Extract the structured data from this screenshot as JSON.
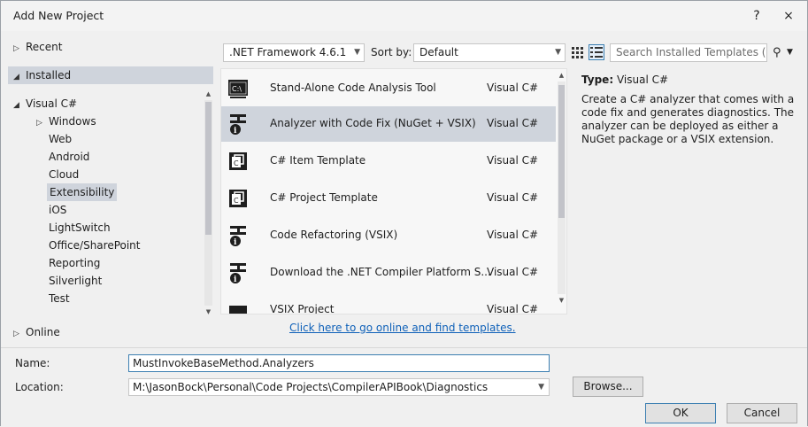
{
  "window": {
    "title": "Add New Project",
    "help": "?",
    "close": "×"
  },
  "tree": {
    "recent": "Recent",
    "installed": "Installed",
    "visual_csharp": "Visual C#",
    "children": [
      "Windows",
      "Web",
      "Android",
      "Cloud",
      "Extensibility",
      "iOS",
      "LightSwitch",
      "Office/SharePoint",
      "Reporting",
      "Silverlight",
      "Test"
    ],
    "online": "Online"
  },
  "toolbar": {
    "framework": ".NET Framework 4.6.1",
    "sort_label": "Sort by:",
    "sort_value": "Default",
    "search_placeholder": "Search Installed Templates (Ct"
  },
  "templates": [
    {
      "name": "Stand-Alone Code Analysis Tool",
      "lang": "Visual C#",
      "icon": "console-cs-icon"
    },
    {
      "name": "Analyzer with Code Fix (NuGet + VSIX)",
      "lang": "Visual C#",
      "icon": "analyzer-icon"
    },
    {
      "name": "C# Item Template",
      "lang": "Visual C#",
      "icon": "item-template-icon"
    },
    {
      "name": "C# Project Template",
      "lang": "Visual C#",
      "icon": "project-template-icon"
    },
    {
      "name": "Code Refactoring (VSIX)",
      "lang": "Visual C#",
      "icon": "refactoring-icon"
    },
    {
      "name": "Download the .NET Compiler Platform S...",
      "lang": "Visual C#",
      "icon": "download-icon"
    },
    {
      "name": "VSIX Project",
      "lang": "Visual C#",
      "icon": "vsix-icon"
    }
  ],
  "detail": {
    "type_label": "Type:",
    "type_value": "Visual C#",
    "description": "Create a C# analyzer that comes with a code fix and generates diagnostics. The analyzer can be deployed as either a NuGet package or a VSIX extension."
  },
  "online_link": "Click here to go online and find templates.",
  "form": {
    "name_label": "Name:",
    "name_value": "MustInvokeBaseMethod.Analyzers",
    "location_label": "Location:",
    "location_value": "M:\\JasonBock\\Personal\\Code Projects\\CompilerAPIBook\\Diagnostics",
    "browse": "Browse...",
    "ok": "OK",
    "cancel": "Cancel"
  },
  "colors": {
    "selection": "#cfd4dc",
    "link": "#0e60b8",
    "accent": "#3c7fb1"
  }
}
